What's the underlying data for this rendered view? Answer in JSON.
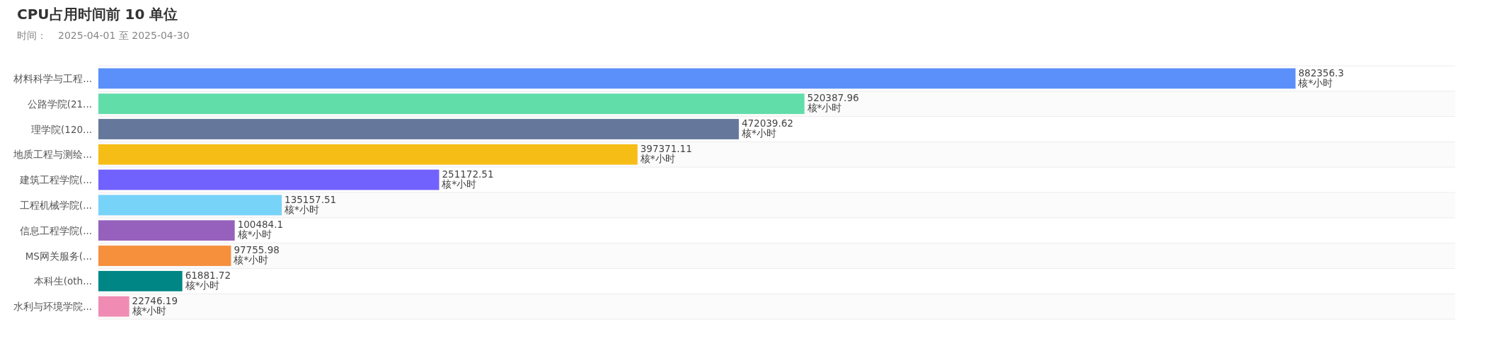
{
  "chart": {
    "title": "CPU占用时间前 10 单位",
    "subtitle_label": "时间：",
    "date_range": "2025-04-01 至 2025-04-30",
    "chart_data": {
      "type": "bar",
      "orientation": "horizontal",
      "data_labels": true,
      "xlim": [
        0,
        1000000
      ],
      "categories": [
        "材料科学与工程...",
        "公路学院(21...",
        "理学院(120...",
        "地质工程与测绘...",
        "建筑工程学院(...",
        "工程机械学院(...",
        "信息工程学院(...",
        "MS网关服务(...",
        "本科生(oth...",
        "水利与环境学院..."
      ],
      "series": [
        {
          "color": "#5b8ff9",
          "values": [
            882356.3,
            null,
            null,
            null,
            null,
            null,
            null,
            null,
            null,
            null
          ]
        },
        {
          "color": "#61ddaa",
          "values": [
            null,
            520387.96,
            null,
            null,
            null,
            null,
            null,
            null,
            null,
            null
          ]
        },
        {
          "color": "#65789b",
          "values": [
            null,
            null,
            472039.62,
            null,
            null,
            null,
            null,
            null,
            null,
            null
          ]
        },
        {
          "color": "#f6bd16",
          "values": [
            null,
            null,
            null,
            397371.11,
            null,
            null,
            null,
            null,
            null,
            null
          ]
        },
        {
          "color": "#7262fd",
          "values": [
            null,
            null,
            null,
            null,
            251172.51,
            null,
            null,
            null,
            null,
            null
          ]
        },
        {
          "color": "#78d3f8",
          "values": [
            null,
            null,
            null,
            null,
            null,
            135157.51,
            null,
            null,
            null,
            null
          ]
        },
        {
          "color": "#9661bc",
          "values": [
            null,
            null,
            null,
            null,
            null,
            null,
            100484.1,
            null,
            null,
            null
          ]
        },
        {
          "color": "#f6903d",
          "values": [
            null,
            null,
            null,
            null,
            null,
            null,
            null,
            97755.98,
            null,
            null
          ]
        },
        {
          "color": "#008685",
          "values": [
            null,
            null,
            null,
            null,
            null,
            null,
            null,
            null,
            61881.72,
            null
          ]
        },
        {
          "color": "#f08bb4",
          "values": [
            null,
            null,
            null,
            null,
            null,
            null,
            null,
            null,
            null,
            22746.19
          ]
        }
      ],
      "value_labels": [
        "882356.3\n核*小时",
        "520387.96\n核*小时",
        "472039.62\n核*小时",
        "397371.11\n核*小时",
        "251172.51\n核*小时",
        "135157.51\n核*小时",
        "100484.1\n核*小时",
        "97755.98\n核*小时",
        "61881.72\n核*小时",
        "22746.19\n核*小时"
      ]
    }
  }
}
